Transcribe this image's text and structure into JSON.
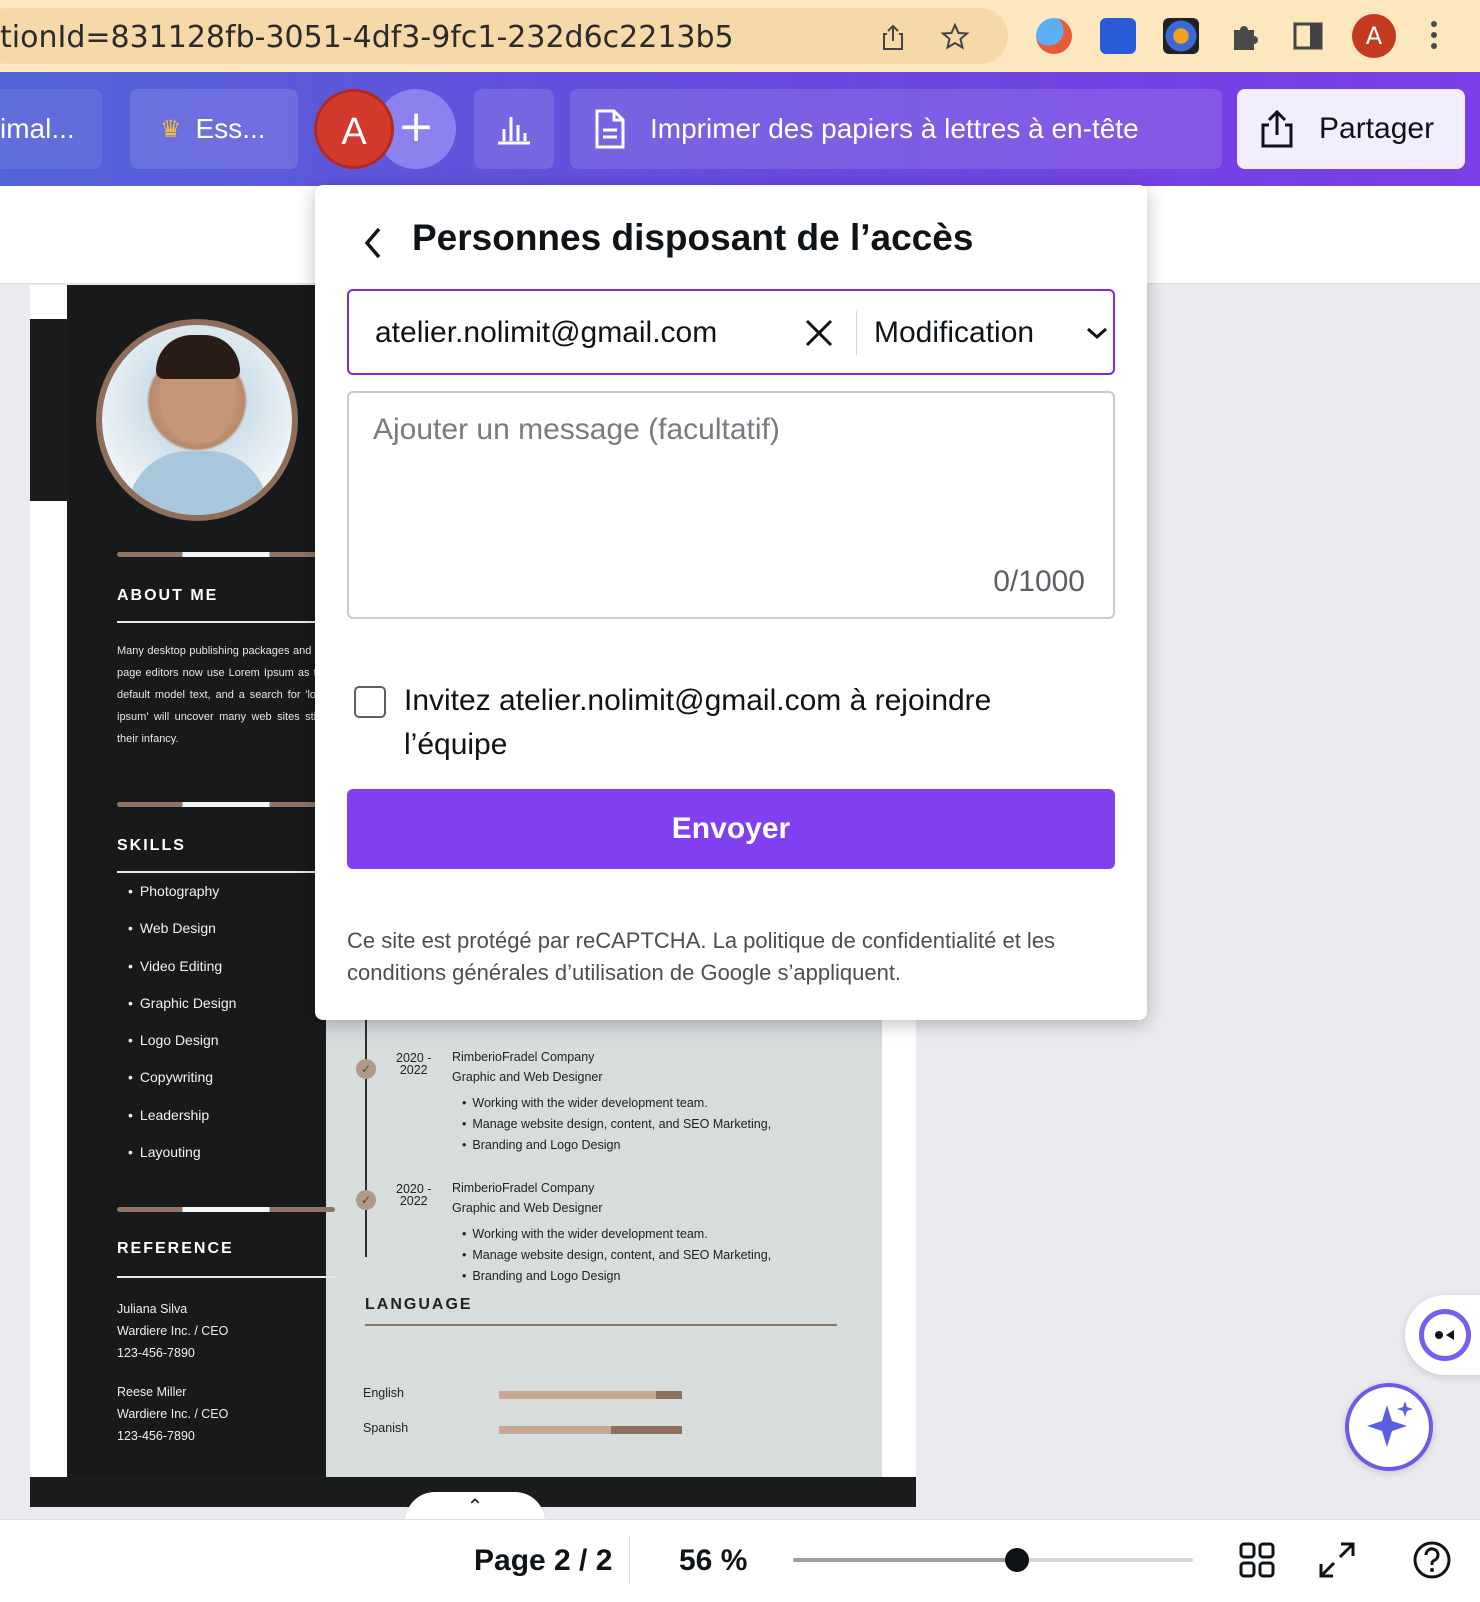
{
  "browser": {
    "url": "tionId=831128fb-3051-4df3-9fc1-232d6c2213b5",
    "profile_initial": "A"
  },
  "toolbar": {
    "tab1_label": "imal...",
    "tab2_label": "Ess...",
    "avatar_initial": "A",
    "add_label": "+",
    "print_label": "Imprimer des papiers à lettres à en-tête",
    "share_label": "Partager"
  },
  "dialog": {
    "title": "Personnes disposant de l’accès",
    "email_value": "atelier.nolimit@gmail.com",
    "role": "Modification",
    "message_placeholder": "Ajouter un message (facultatif)",
    "message_count": "0/1000",
    "invite_label": "Invitez atelier.nolimit@gmail.com à rejoindre l’équipe",
    "invite_checked": false,
    "send_label": "Envoyer",
    "legal_text": "Ce site est protégé par reCAPTCHA. La politique de confidentialité et les conditions générales d’utilisation de Google s’appliquent."
  },
  "resume": {
    "about_title": "ABOUT ME",
    "about_text": "Many desktop publishing packages and web page editors now use Lorem Ipsum as their default model text, and a search for 'lorem ipsum' will uncover many web sites still in their infancy.",
    "skills_title": "SKILLS",
    "skills": [
      "Photography",
      "Web Design",
      "Video Editing",
      "Graphic Design",
      "Logo Design",
      "Copywriting",
      "Leadership",
      "Layouting"
    ],
    "reference_title": "REFERENCE",
    "references": [
      {
        "name": "Juliana Silva",
        "company": "Wardiere Inc. / CEO",
        "phone": "123-456-7890"
      },
      {
        "name": "Reese Miller",
        "company": "Wardiere Inc. / CEO",
        "phone": "123-456-7890"
      }
    ],
    "experience": [
      {
        "year_start": "2020 -",
        "year_end": "2022",
        "company": "RimberioFradel Company",
        "role": "Graphic and Web Designer",
        "bullets": [
          "Working with the wider development team.",
          "Manage website design, content, and SEO Marketing,",
          "Branding and Logo Design"
        ]
      },
      {
        "year_start": "2020 -",
        "year_end": "2022",
        "company": "RimberioFradel Company",
        "role": "Graphic and Web Designer",
        "bullets": [
          "Working with the wider development team.",
          "Manage website design, content, and SEO Marketing,",
          "Branding and Logo Design"
        ]
      }
    ],
    "language_title": "LANGUAGE",
    "languages": [
      {
        "name": "English",
        "level": 0.86
      },
      {
        "name": "Spanish",
        "level": 0.61
      }
    ]
  },
  "bottom_bar": {
    "page_indicator": "Page 2 / 2",
    "zoom": "56 %",
    "zoom_level": 0.56
  },
  "colors": {
    "accent": "#8040f0",
    "toolbar_start": "#5363d8",
    "toolbar_end": "#7a3fe6"
  }
}
